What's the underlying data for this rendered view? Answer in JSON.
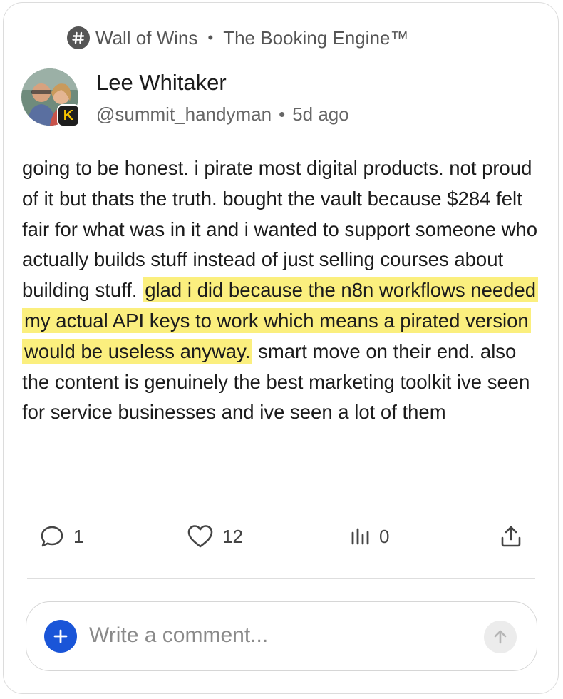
{
  "post": {
    "community": "Wall of Wins",
    "separator": "•",
    "product": "The Booking Engine™",
    "author": {
      "name": "Lee Whitaker",
      "handle": "@summit_handyman",
      "time_ago": "5d ago",
      "badge": "K"
    },
    "body": {
      "before": "going to be honest. i pirate most digital products. not proud of it but thats the truth. bought the vault because $284 felt fair for what was in it and i wanted to support someone who actually builds stuff instead of just selling courses about building stuff. ",
      "highlight": "glad i did because the n8n workflows needed my actual API keys to work which means a pirated version would be useless anyway.",
      "after": " smart move on their end. also the content is genuinely the best marketing toolkit ive seen for service businesses and ive seen a lot of them"
    }
  },
  "actions": {
    "comments": "1",
    "likes": "12",
    "views": "0"
  },
  "comment": {
    "placeholder": "Write a comment..."
  },
  "colors": {
    "highlight": "#fbef7e",
    "add_button": "#1a55d8",
    "icon_gray": "#444444"
  }
}
